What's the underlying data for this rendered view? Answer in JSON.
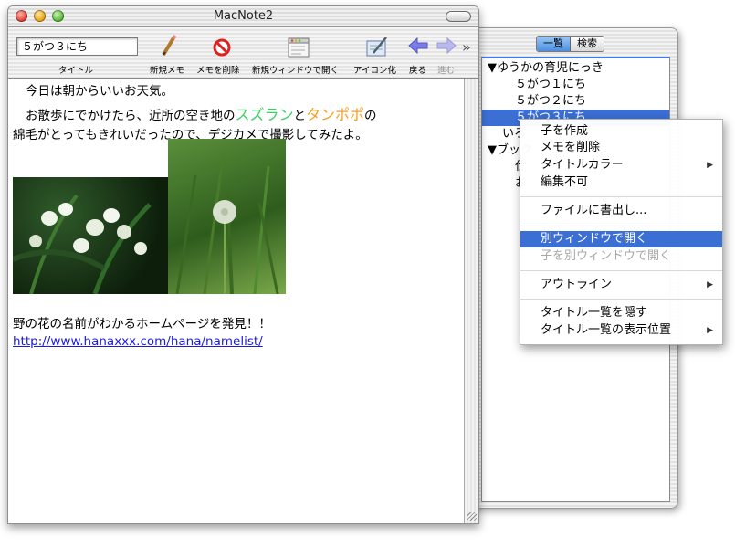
{
  "window": {
    "title": "MacNote2"
  },
  "toolbar": {
    "title_value": "５がつ３にち",
    "title_label": "タイトル",
    "new_memo": "新規メモ",
    "delete_memo": "メモを削除",
    "open_new_window": "新規ウィンドウで開く",
    "iconize": "アイコン化",
    "back": "戻る",
    "forward": "進む",
    "overflow": "»"
  },
  "content": {
    "line1": "今日は朝からいいお天気。",
    "line2_pre": "お散歩にでかけたら、近所の空き地の",
    "suzuran": "スズラン",
    "to": "と",
    "tanpopo": "タンポポ",
    "no": "の",
    "line3": "綿毛がとってもきれいだったので、デジカメで撮影してみたよ。",
    "line4": "野の花の名前がわかるホームページを発見！！",
    "link": "http://www.hanaxxx.com/hana/namelist/"
  },
  "drawer": {
    "tabs": {
      "list": "一覧",
      "search": "検索"
    },
    "outline": {
      "root1": "▼ゆうかの育児にっき",
      "item1": "５がつ１にち",
      "item2": "５がつ２にち",
      "item3": "５がつ３にち",
      "root2_partial": "いろ",
      "root3_partial": "▼ブック",
      "sub1_partial": "仕",
      "sub2_partial": "お"
    }
  },
  "context_menu": {
    "create_child": "子を作成",
    "delete_memo": "メモを削除",
    "title_color": "タイトルカラー",
    "not_editable": "編集不可",
    "export_file": "ファイルに書出し...",
    "open_separate": "別ウィンドウで開く",
    "open_child_separate": "子を別ウィンドウで開く",
    "outline": "アウトライン",
    "hide_title_list": "タイトル一覧を隠す",
    "title_list_position": "タイトル一覧の表示位置",
    "submenu_arrow": "▶"
  }
}
